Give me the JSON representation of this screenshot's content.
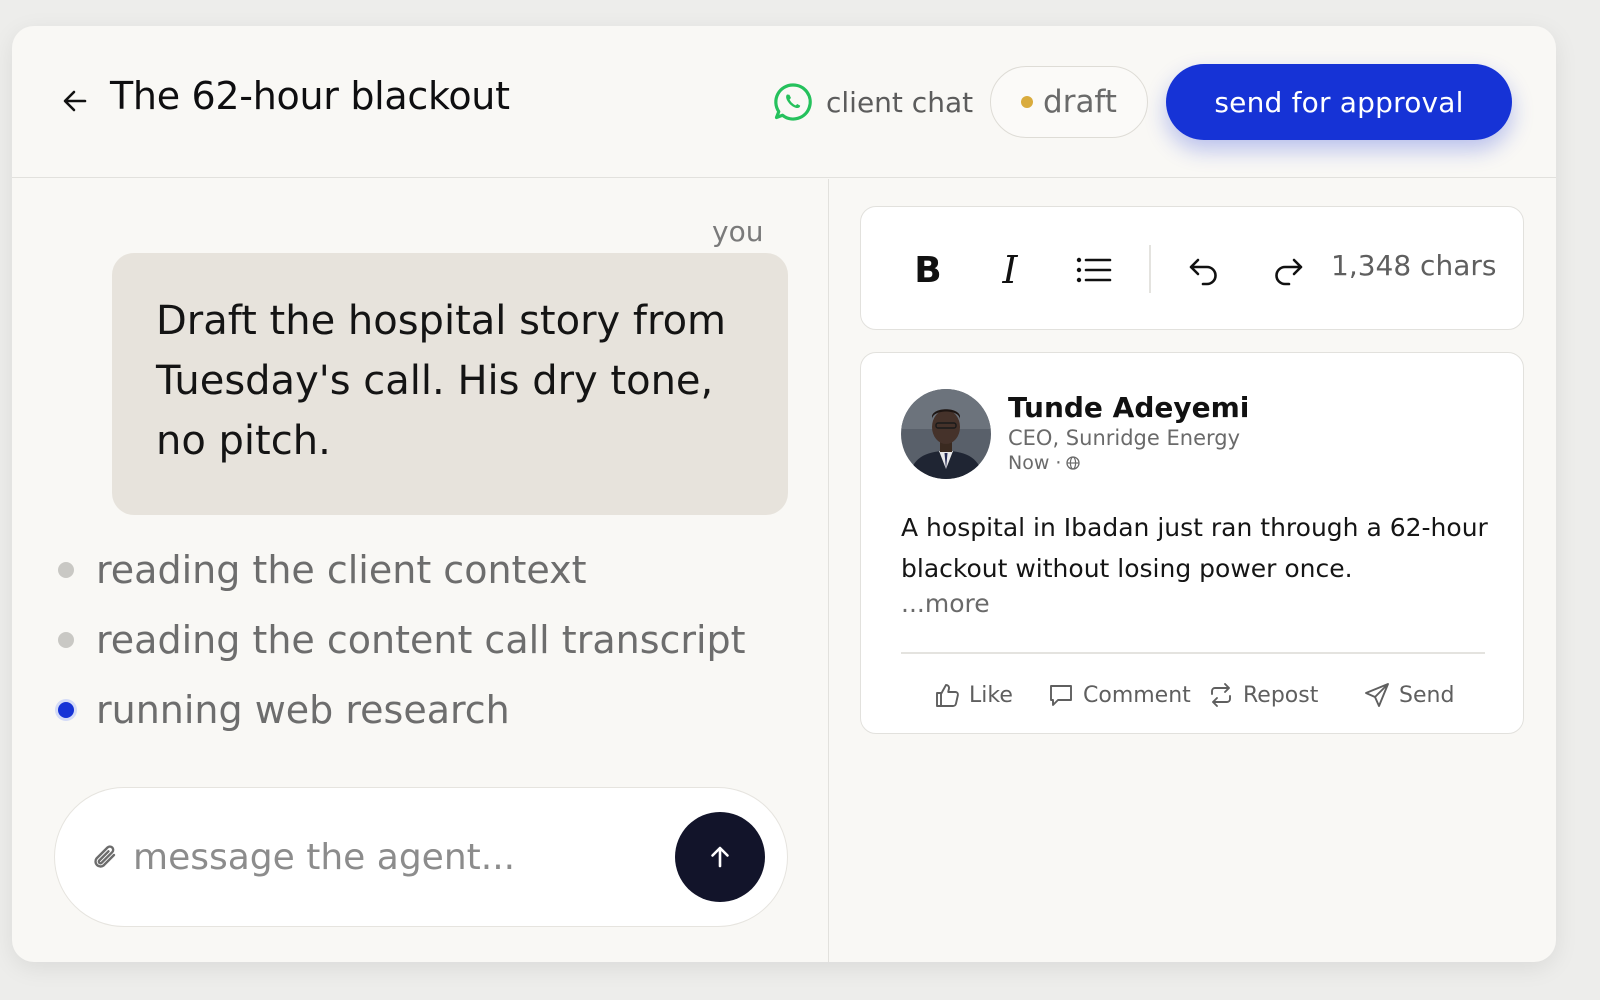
{
  "header": {
    "title": "The 62-hour blackout",
    "channel_label": "client chat",
    "channel_icon": "whatsapp-icon",
    "status_label": "draft",
    "status_color": "#d9ab3d",
    "approve_label": "send for approval",
    "accent_color": "#1633d6"
  },
  "chat": {
    "sender_label": "you",
    "message": "Draft the hospital story from Tuesday's call. His dry tone, no pitch.",
    "steps": [
      {
        "label": "reading the client context",
        "state": "done"
      },
      {
        "label": "reading the content call transcript",
        "state": "done"
      },
      {
        "label": "running web research",
        "state": "active"
      }
    ],
    "composer_placeholder": "message the agent..."
  },
  "editor": {
    "tools": [
      "bold-icon",
      "italic-icon",
      "bullet-list-icon",
      "undo-icon",
      "redo-icon"
    ],
    "char_count": "1,348 chars"
  },
  "post": {
    "author_name": "Tunde Adeyemi",
    "author_role": "CEO, Sunridge Energy",
    "time": "Now ·",
    "body": "A hospital in Ibadan just ran through a 62-hour blackout without losing power once.",
    "more_label": "...more",
    "actions": [
      {
        "icon": "thumbs-up-icon",
        "label": "Like"
      },
      {
        "icon": "comment-icon",
        "label": "Comment"
      },
      {
        "icon": "repost-icon",
        "label": "Repost"
      },
      {
        "icon": "send-plane-icon",
        "label": "Send"
      }
    ]
  }
}
